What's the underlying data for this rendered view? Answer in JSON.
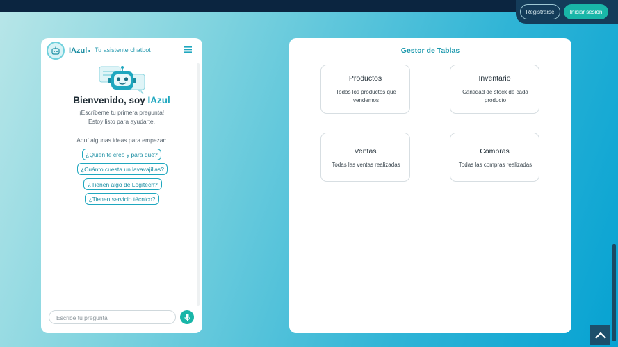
{
  "auth": {
    "register_label": "Registrarse",
    "login_label": "Iniciar sesión"
  },
  "chat": {
    "name": "IAzul",
    "subtitle": "Tu asistente chatbot",
    "welcome_prefix": "Bienvenido, soy ",
    "welcome_brand": "IAzul",
    "line1": "¡Escríbeme tu primera pregunta!",
    "line2": "Estoy listo para ayudarte.",
    "ideas_label": "Aquí algunas ideas para empezar:",
    "suggestions": [
      "¿Quién te creó y para qué?",
      "¿Cuánto cuesta un lavavajillas?",
      "¿Tienen algo de Logitech?",
      "¿Tienen servicio técnico?"
    ],
    "input_placeholder": "Escribe tu pregunta",
    "icons": {
      "avatar": "robot-icon",
      "menu": "list-icon",
      "mic": "microphone-icon"
    }
  },
  "tables": {
    "title": "Gestor de Tablas",
    "cards": [
      {
        "title": "Productos",
        "desc": "Todos los productos que vendemos"
      },
      {
        "title": "Inventario",
        "desc": "Cantidad de stock de cada producto"
      },
      {
        "title": "Ventas",
        "desc": "Todas las ventas realizadas"
      },
      {
        "title": "Compras",
        "desc": "Todas las compras realizadas"
      }
    ]
  },
  "colors": {
    "accent": "#19b6a8",
    "brand": "#1fa7bf",
    "navbar": "#0b2540"
  }
}
